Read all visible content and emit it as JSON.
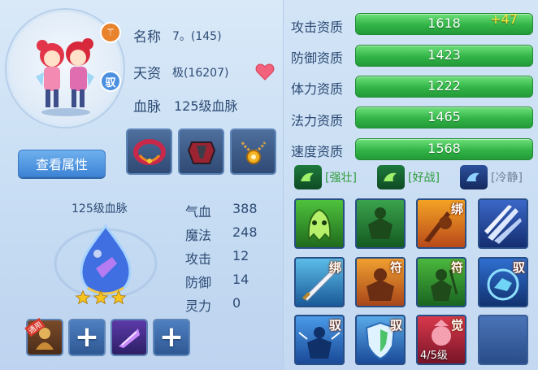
{
  "profile": {
    "name_label": "名称",
    "name_value": "7。(145)",
    "talent_label": "天资",
    "talent_value": "极(16207)",
    "bloodline_label": "血脉",
    "bloodline_value": "125级血脉",
    "badge_top": "⚚",
    "badge_mid": "驭"
  },
  "buttons": {
    "view_attributes": "查看属性"
  },
  "bloodline": {
    "title": "125级血脉",
    "stars": 3,
    "stats": [
      {
        "label": "气血",
        "value": "388"
      },
      {
        "label": "魔法",
        "value": "248"
      },
      {
        "label": "攻击",
        "value": "12"
      },
      {
        "label": "防御",
        "value": "14"
      },
      {
        "label": "灵力",
        "value": "0"
      }
    ],
    "slot_tag": "通用"
  },
  "aptitudes": [
    {
      "label": "攻击资质",
      "value": "1618",
      "bonus": "+47"
    },
    {
      "label": "防御资质",
      "value": "1423",
      "bonus": ""
    },
    {
      "label": "体力资质",
      "value": "1222",
      "bonus": ""
    },
    {
      "label": "法力资质",
      "value": "1465",
      "bonus": ""
    },
    {
      "label": "速度资质",
      "value": "1568",
      "bonus": ""
    }
  ],
  "traits": [
    {
      "label": "[强壮]",
      "color": "#2f9c3b"
    },
    {
      "label": "[好战]",
      "color": "#2f9c3b"
    },
    {
      "label": "[冷静]",
      "color": "#6f7f98"
    }
  ],
  "skills": {
    "tag_bind": "绑",
    "tag_fu": "符",
    "tag_yu": "驭",
    "tag_jue": "觉",
    "awaken_level": "4/5级"
  },
  "colors": {
    "accent_blue": "#3d84d6",
    "aptitude_green": "#32b447",
    "bonus_yellow": "#f4ef45",
    "text_navy": "#2d4b74"
  }
}
